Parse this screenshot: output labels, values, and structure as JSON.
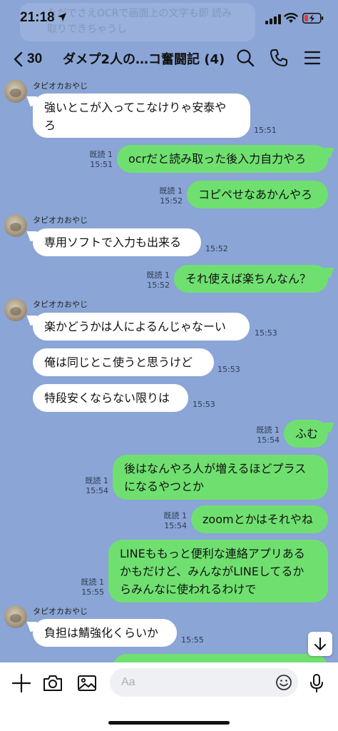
{
  "status_bar": {
    "time": "21:18",
    "ghost_text": "ただでさえOCRで画面上の文字も即 読み取りできちゃうし"
  },
  "header": {
    "back_count": "30",
    "title": "ダメプ2人の…コ奮闘記 (4)",
    "icons": [
      "search-icon",
      "phone-icon",
      "menu-icon"
    ]
  },
  "messages": [
    {
      "sender": "タピオカおやじ",
      "text": [
        "強いとこが入ってこなけりゃ安泰や",
        "ろ"
      ],
      "time": "15:51"
    },
    {
      "read": "既読 1",
      "time": "15:51",
      "text": [
        "ocrだと読み取った後入力自力やろ"
      ]
    },
    {
      "read": "既読 1",
      "time": "15:52",
      "text": [
        "コピペせなあかんやろ"
      ]
    },
    {
      "sender": "タピオカおやじ",
      "text": [
        "専用ソフトで入力も出来る"
      ],
      "time": "15:52"
    },
    {
      "read": "既読 1",
      "time": "15:52",
      "text": [
        "それ使えば楽ちんなん？"
      ]
    },
    {
      "sender": "タピオカおやじ",
      "text": [
        "楽かどうかは人によるんじゃなーい"
      ],
      "time": "15:53"
    },
    {
      "text": [
        "俺は同じとこ使うと思うけど"
      ],
      "time": "15:53"
    },
    {
      "text": [
        "特段安くならない限りは"
      ],
      "time": "15:53"
    },
    {
      "read": "既読 1",
      "time": "15:54",
      "text": [
        "ふむ"
      ]
    },
    {
      "read": "既読 1",
      "time": "15:54",
      "text": [
        "後はなんやろ人が増えるほどプラス",
        "になるやつとか"
      ]
    },
    {
      "read": "既読 1",
      "time": "15:54",
      "text": [
        "zoomとかはそれやね"
      ]
    },
    {
      "read": "既読 1",
      "time": "15:55",
      "text": [
        "LINEももっと便利な連絡アプリある",
        "かもだけど、みんながLINEしてるか",
        "らみんなに使われるわけで"
      ]
    },
    {
      "sender": "タピオカおやじ",
      "text": [
        "負担は鯖強化くらいか"
      ],
      "time": "15:55"
    }
  ],
  "input": {
    "placeholder": "Aa"
  },
  "colors": {
    "background": "#8aa5d6",
    "incoming_bubble": "#ffffff",
    "outgoing_bubble": "#6fe070"
  }
}
